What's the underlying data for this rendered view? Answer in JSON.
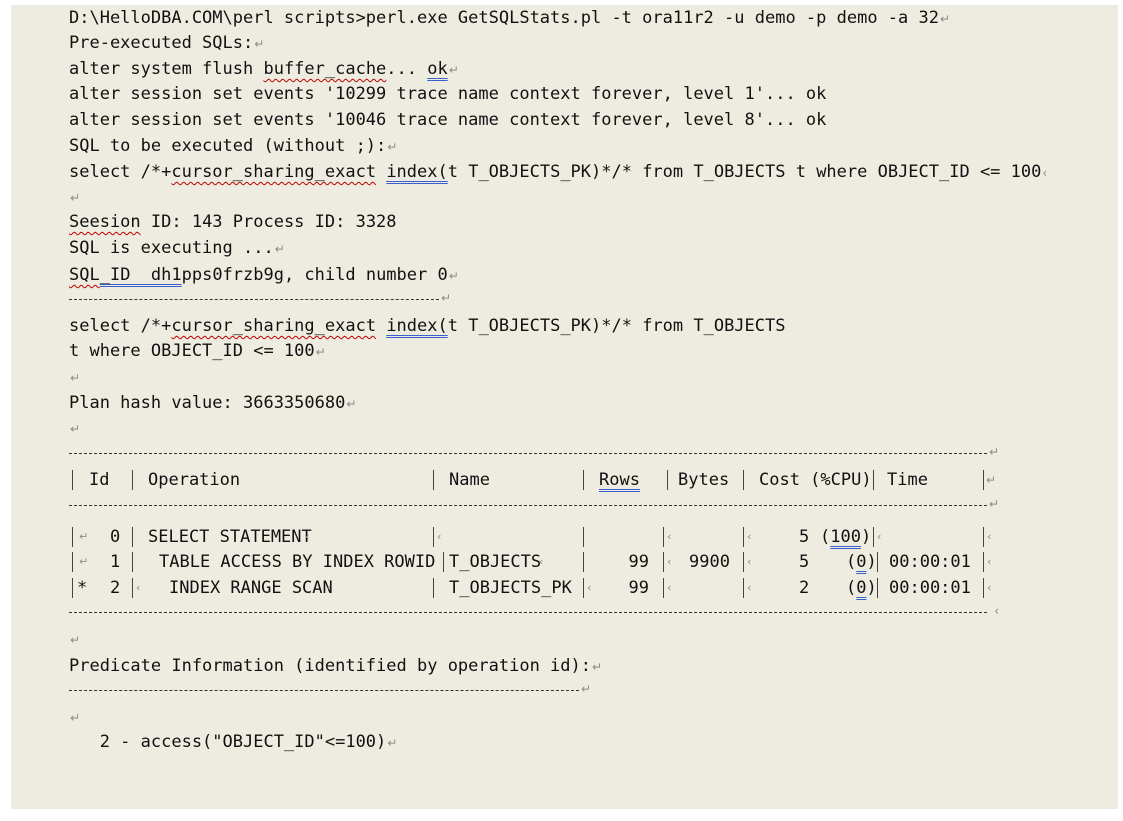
{
  "lines": {
    "cmd": "D:\\HelloDBA.COM\\perl scripts>perl.exe GetSQLStats.pl -t ora11r2 -u demo -p demo -a 32",
    "pre": "Pre-executed SQLs:",
    "flush_a": "alter system flush ",
    "flush_b": "buffer_cache",
    "flush_c": "... ",
    "flush_d": "ok",
    "ev1": "alter session set events '10299 trace name context forever, level 1'... ok",
    "ev2": "alter session set events '10046 trace name context forever, level 8'... ok",
    "tobe": "SQL to be executed (without ;):",
    "sel_a": "select /*+",
    "sel_b": "cursor_sharing_exact",
    "sel_c": " ",
    "sel_d": "index(",
    "sel_e": "t T_OBJECTS_PK)*/* from T_OBJECTS t where OBJECT_ID <= 100",
    "sess_a": "Seesion",
    "sess_b": " ID: 143 Process ID: 3328",
    "exec": "SQL is executing ...",
    "sqlid_a": "SQL",
    "sqlid_b": "_ID  dh1",
    "sqlid_c": "pps0frzb9g, child number 0",
    "sel2_a": "select /*+",
    "sel2_b": "cursor_sharing_exact",
    "sel2_c": " ",
    "sel2_d": "index(",
    "sel2_e": "t T_OBJECTS_PK)*/* from T_OBJECTS",
    "sel2_f": "t where OBJECT_ID <= 100",
    "plan": "Plan hash value: 3663350680",
    "pred": "Predicate Information (identified by operation id):",
    "access": "   2 - access(\"OBJECT_ID\"<=100)"
  },
  "plan_table": {
    "headers": {
      "id": "Id",
      "operation": "Operation",
      "name": "Name",
      "rows": "Rows",
      "bytes": "Bytes",
      "cost": "Cost (%CPU)",
      "time": "Time"
    },
    "rows": [
      {
        "star": "",
        "id": "0",
        "operation": "SELECT STATEMENT",
        "name": "",
        "rows": "",
        "bytes": "",
        "cost": "5",
        "cpu": "100",
        "time": ""
      },
      {
        "star": "",
        "id": "1",
        "operation": "TABLE ACCESS BY INDEX ROWID",
        "name": "T_OBJECTS",
        "rows": "99",
        "bytes": "9900",
        "cost": "5",
        "cpu": "0",
        "time": "00:00:01"
      },
      {
        "star": "*",
        "id": "2",
        "operation": "INDEX RANGE SCAN",
        "name": "T_OBJECTS_PK",
        "rows": "99",
        "bytes": "",
        "cost": "2",
        "cpu": "0",
        "time": "00:00:01"
      }
    ]
  },
  "marks": {
    "paragraph": "↵",
    "cell": "‹"
  }
}
